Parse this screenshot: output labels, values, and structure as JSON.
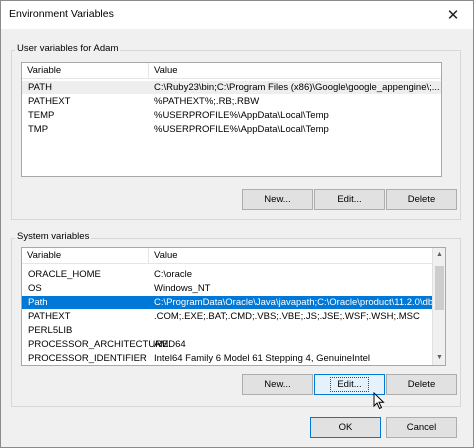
{
  "window": {
    "title": "Environment Variables",
    "close_glyph": "✕"
  },
  "user_section": {
    "label": "User variables for Adam",
    "columns": [
      "Variable",
      "Value"
    ],
    "rows": [
      {
        "variable": "PATH",
        "value": "C:\\Ruby23\\bin;C:\\Program Files (x86)\\Google\\google_appengine\\;..."
      },
      {
        "variable": "PATHEXT",
        "value": "%PATHEXT%;.RB;.RBW"
      },
      {
        "variable": "TEMP",
        "value": "%USERPROFILE%\\AppData\\Local\\Temp"
      },
      {
        "variable": "TMP",
        "value": "%USERPROFILE%\\AppData\\Local\\Temp"
      }
    ],
    "buttons": {
      "new": "New...",
      "edit": "Edit...",
      "delete": "Delete"
    }
  },
  "system_section": {
    "label": "System variables",
    "columns": [
      "Variable",
      "Value"
    ],
    "rows": [
      {
        "variable": "ORACLE_HOME",
        "value": "C:\\oracle"
      },
      {
        "variable": "OS",
        "value": "Windows_NT"
      },
      {
        "variable": "Path",
        "value": "C:\\ProgramData\\Oracle\\Java\\javapath;C:\\Oracle\\product\\11.2.0\\db..."
      },
      {
        "variable": "PATHEXT",
        "value": ".COM;.EXE;.BAT;.CMD;.VBS;.VBE;.JS;.JSE;.WSF;.WSH;.MSC"
      },
      {
        "variable": "PERL5LIB",
        "value": ""
      },
      {
        "variable": "PROCESSOR_ARCHITECTURE",
        "value": "AMD64"
      },
      {
        "variable": "PROCESSOR_IDENTIFIER",
        "value": "Intel64 Family 6 Model 61 Stepping 4, GenuineIntel"
      }
    ],
    "selected_index": 2,
    "buttons": {
      "new": "New...",
      "edit": "Edit...",
      "delete": "Delete"
    }
  },
  "footer": {
    "ok": "OK",
    "cancel": "Cancel"
  },
  "colors": {
    "selection": "#0078d7",
    "focus_border": "#0078d7"
  }
}
